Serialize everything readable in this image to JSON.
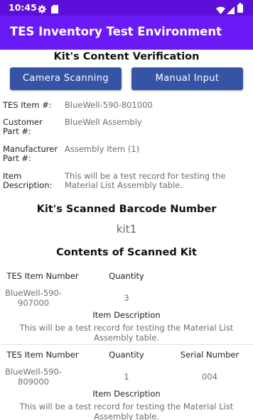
{
  "status_bar": {
    "time": "10:45",
    "icons": [
      "gear-icon",
      "sd-card-icon",
      "wifi-icon",
      "signal-icon",
      "battery-icon"
    ]
  },
  "app_bar": {
    "title": "TES Inventory Test Environment",
    "color": "#6a1bf5"
  },
  "verification": {
    "heading": "Kit's Content Verification",
    "camera_button": "Camera Scanning",
    "manual_button": "Manual Input",
    "fields": [
      {
        "label": "TES Item #:",
        "value": "BlueWell-590-801000"
      },
      {
        "label": "Customer Part #:",
        "value": "BlueWell Assembly"
      },
      {
        "label": "Manufacturer Part #:",
        "value": "Assembly Item (1)"
      },
      {
        "label": "Item Description:",
        "value": "This will be a test record for testing the Material List Assembly table."
      }
    ]
  },
  "scanned": {
    "heading": "Kit's Scanned Barcode Number",
    "barcode": "kit1"
  },
  "contents": {
    "heading": "Contents of Scanned Kit",
    "items": [
      {
        "col_item": "TES Item Number",
        "col_qty": "Quantity",
        "item_number": "BlueWell-590-907000",
        "quantity": "3",
        "desc_label": "Item Description",
        "description": "This will be a test record for testing the Material List Assembly table."
      },
      {
        "col_item": "TES Item Number",
        "col_qty": "Quantity",
        "col_serial": "Serial Number",
        "item_number": "BlueWell-590-809000",
        "quantity": "1",
        "serial": "004",
        "desc_label": "Item Description",
        "description": "This will be a test record for testing the Material List Assembly table."
      }
    ]
  }
}
